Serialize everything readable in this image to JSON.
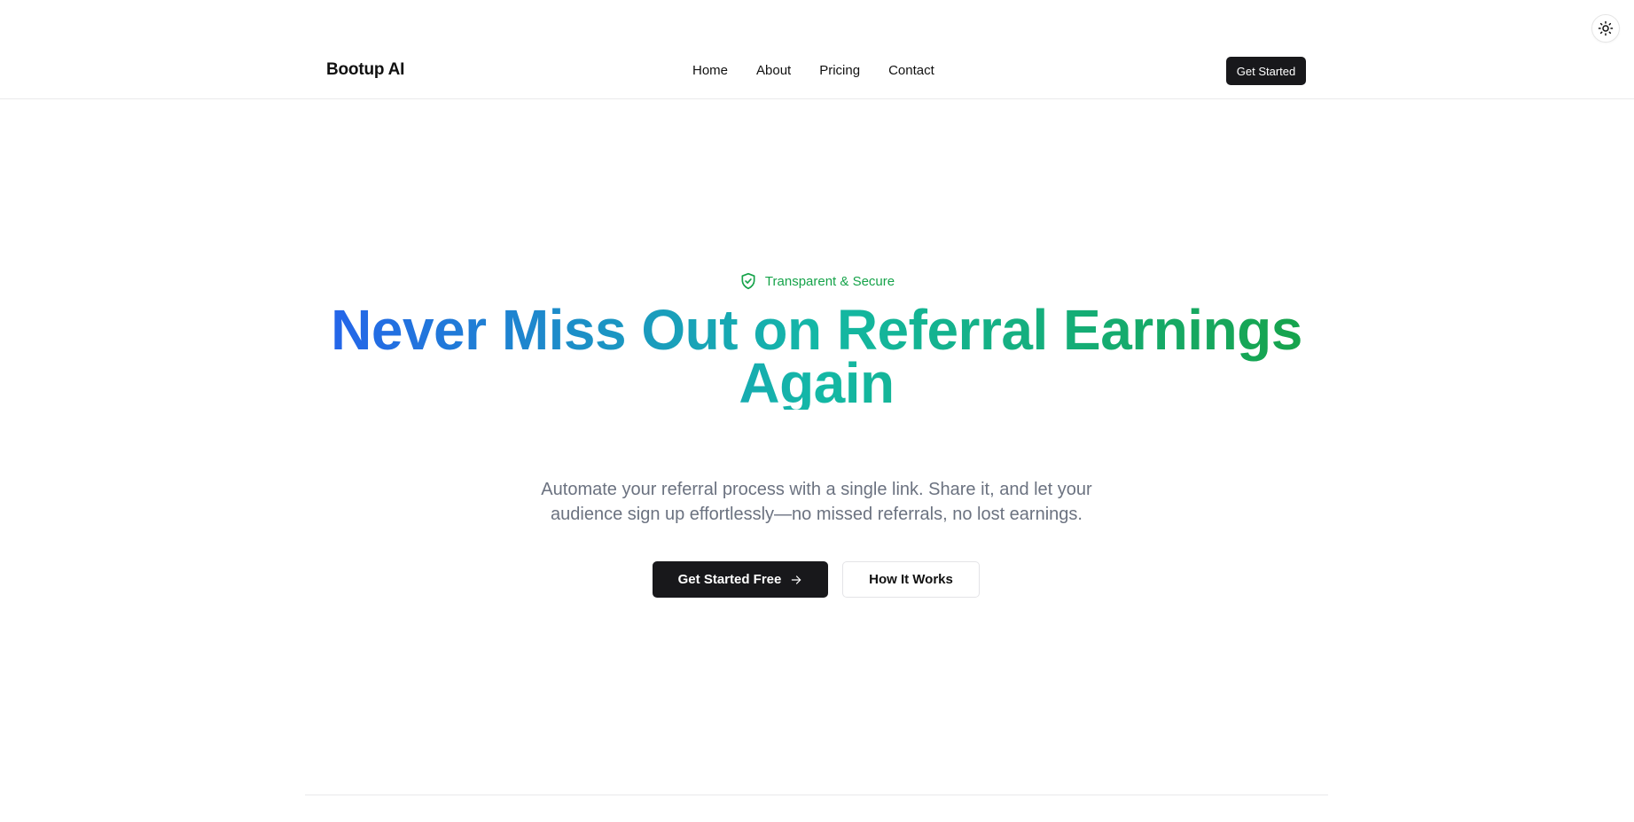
{
  "header": {
    "brand": "Bootup AI",
    "nav": [
      "Home",
      "About",
      "Pricing",
      "Contact"
    ],
    "cta_label": "Get Started"
  },
  "theme_toggle": {
    "icon": "sun-icon"
  },
  "hero": {
    "badge": {
      "icon": "shield-check-icon",
      "label": "Transparent & Secure"
    },
    "headline_line1": "Never Miss Out on Referral Earnings",
    "headline_line2": "Again",
    "subtitle_line1": "Automate your referral process with a single link. Share it, and let your",
    "subtitle_line2": "audience sign up effortlessly—no missed referrals, no lost earnings.",
    "primary_button": {
      "label": "Get Started Free",
      "icon": "arrow-right-icon"
    },
    "secondary_button": {
      "label": "How It Works"
    }
  },
  "colors": {
    "headline_gradient": [
      "#2563eb",
      "#14b8a6",
      "#16a34a"
    ],
    "badge": "#16a34a",
    "primary_button_bg": "#18181b",
    "subtitle": "#6b7280"
  }
}
